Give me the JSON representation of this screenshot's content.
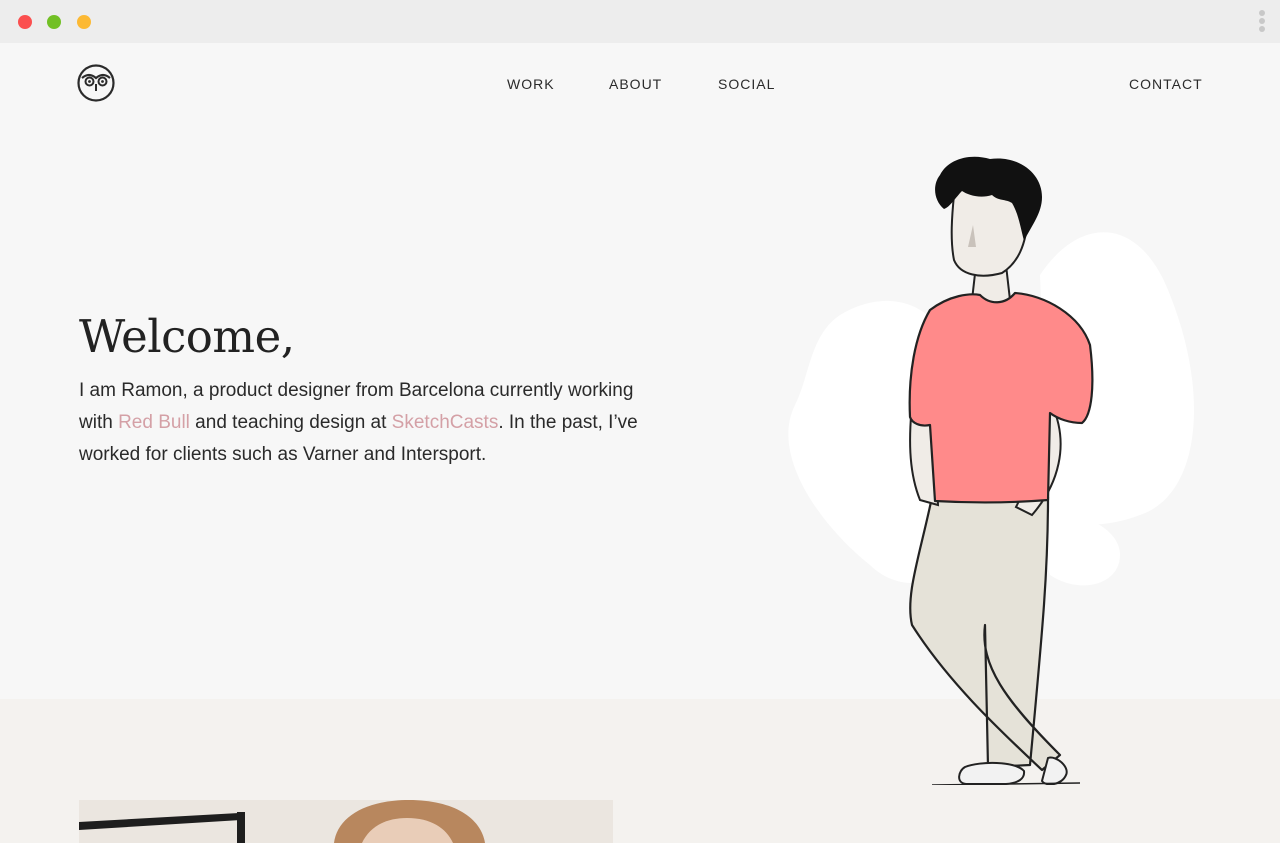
{
  "nav": {
    "work": "WORK",
    "about": "ABOUT",
    "social": "SOCIAL",
    "contact": "CONTACT"
  },
  "hero": {
    "heading": "Welcome,",
    "intro_part1": "I am Ramon, a product designer from Barcelona currently working with ",
    "link_redbull": "Red Bull",
    "intro_part2": " and teaching design at ",
    "link_sketchcasts": "SketchCasts",
    "intro_part3": ". In the past, I’ve worked for clients such as Varner and Intersport."
  },
  "icons": {
    "logo": "owl-face-icon",
    "window_menu": "vertical-dots-icon"
  },
  "colors": {
    "background": "#f7f7f7",
    "link": "#d4a0a6",
    "shirt": "#ff8a8a",
    "pants": "#e5e2d8",
    "beige_section": "#f4f2ef"
  }
}
